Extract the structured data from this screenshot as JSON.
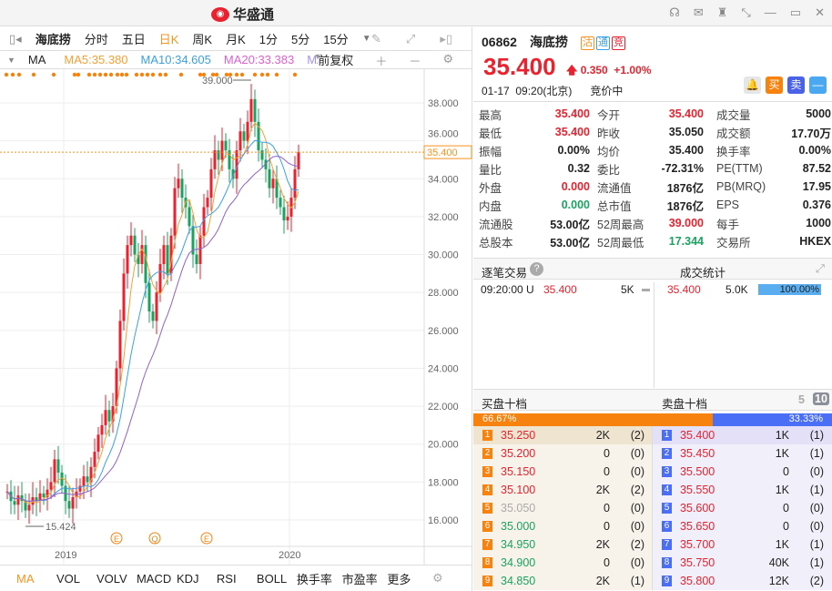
{
  "app": {
    "title": "华盛通",
    "window_controls": [
      "headset-icon",
      "mail-icon",
      "shirt-icon",
      "collapse-icon",
      "minimize-icon",
      "maximize-icon",
      "close-icon"
    ]
  },
  "toolbar": {
    "stock": "海底捞",
    "periods": [
      "分时",
      "五日",
      "日K",
      "周K",
      "月K",
      "1分",
      "5分",
      "15分"
    ],
    "active": "日K"
  },
  "ma": {
    "label": "MA",
    "ma5": "MA5:35.380",
    "ma10": "MA10:34.605",
    "ma20": "MA20:33.383",
    "ma_more": "MA",
    "adjust": "前复权"
  },
  "colors": {
    "up": "#e8222e",
    "down": "#1aa260",
    "ma5": "#f7a035",
    "ma10": "#3aa0e8",
    "ma20": "#e060d0",
    "accent": "#f7931e"
  },
  "chart_data": {
    "type": "candlestick",
    "y_ticks": [
      "38.000",
      "36.000",
      "34.000",
      "32.000",
      "30.000",
      "28.000",
      "26.000",
      "24.000",
      "22.000",
      "20.000",
      "18.000",
      "16.000"
    ],
    "ylim": [
      15,
      39.5
    ],
    "x_labels": [
      "2019",
      "2020"
    ],
    "high_label": "39.000",
    "low_label": "15.424",
    "last_price_label": "35.400",
    "event_markers": [
      "E",
      "Q",
      "E"
    ],
    "closes": [
      17.5,
      17.0,
      16.8,
      17.3,
      17.0,
      16.5,
      16.8,
      17.2,
      17.0,
      17.4,
      17.2,
      17.6,
      18.0,
      19.2,
      18.5,
      17.8,
      17.0,
      16.6,
      17.2,
      17.5,
      17.8,
      18.3,
      18.0,
      18.8,
      19.6,
      20.5,
      21.0,
      21.8,
      21.2,
      22.0,
      24.0,
      26.5,
      29.0,
      30.5,
      31.0,
      30.0,
      29.5,
      30.5,
      28.5,
      27.0,
      26.5,
      28.0,
      29.5,
      30.5,
      29.0,
      31.0,
      33.5,
      34.0,
      33.0,
      32.5,
      31.5,
      30.0,
      29.5,
      31.0,
      32.5,
      33.0,
      34.5,
      35.5,
      35.0,
      36.0,
      35.5,
      34.5,
      34.0,
      35.5,
      36.5,
      36.0,
      37.0,
      38.2,
      37.0,
      35.5,
      35.0,
      34.5,
      33.5,
      34.0,
      33.0,
      32.5,
      31.8,
      32.0,
      33.0,
      34.5,
      35.4
    ]
  },
  "indicators": [
    "MA",
    "VOL",
    "VOLV",
    "MACD",
    "KDJ",
    "RSI",
    "BOLL",
    "换手率",
    "市盈率",
    "更多"
  ],
  "quote": {
    "code": "06862",
    "name": "海底捞",
    "tags": [
      "沽",
      "通",
      "竞"
    ],
    "price": "35.400",
    "change": "0.350",
    "change_pct": "+1.00%",
    "date": "01-17",
    "time": "09:20(北京)",
    "status": "竞价中",
    "buttons": [
      "买",
      "卖"
    ]
  },
  "stats": [
    [
      "最高",
      "35.400",
      "今开",
      "35.400",
      "成交量",
      "5000"
    ],
    [
      "最低",
      "35.400",
      "昨收",
      "35.050",
      "成交额",
      "17.70万"
    ],
    [
      "振幅",
      "0.00%",
      "均价",
      "35.400",
      "换手率",
      "0.00%"
    ],
    [
      "量比",
      "0.32",
      "委比",
      "-72.31%",
      "PE(TTM)",
      "87.52"
    ],
    [
      "外盘",
      "0.000",
      "流通值",
      "1876亿",
      "PB(MRQ)",
      "17.95"
    ],
    [
      "内盘",
      "0.000",
      "总市值",
      "1876亿",
      "EPS",
      "0.376"
    ],
    [
      "流通股",
      "53.00亿",
      "52周最高",
      "39.000",
      "每手",
      "1000"
    ],
    [
      "总股本",
      "53.00亿",
      "52周最低",
      "17.344",
      "交易所",
      "HKEX"
    ]
  ],
  "trades": {
    "title": "逐笔交易",
    "stats_title": "成交统计",
    "rows": [
      {
        "time": "09:20:00 U",
        "price": "35.400",
        "vol": "5K"
      }
    ],
    "stat_rows": [
      {
        "price": "35.400",
        "vol": "5.0K",
        "pct": "100.00%"
      }
    ]
  },
  "orderbook": {
    "bid_title": "买盘十档",
    "ask_title": "卖盘十档",
    "level_5": "5",
    "level_10": "10",
    "bid_pct": "66.67%",
    "ask_pct": "33.33%",
    "bids": [
      [
        "1",
        "35.250",
        "2K",
        "(2)"
      ],
      [
        "2",
        "35.200",
        "0",
        "(0)"
      ],
      [
        "3",
        "35.150",
        "0",
        "(0)"
      ],
      [
        "4",
        "35.100",
        "2K",
        "(2)"
      ],
      [
        "5",
        "35.050",
        "0",
        "(0)"
      ],
      [
        "6",
        "35.000",
        "0",
        "(0)"
      ],
      [
        "7",
        "34.950",
        "2K",
        "(2)"
      ],
      [
        "8",
        "34.900",
        "0",
        "(0)"
      ],
      [
        "9",
        "34.850",
        "2K",
        "(1)"
      ]
    ],
    "asks": [
      [
        "1",
        "35.400",
        "1K",
        "(1)"
      ],
      [
        "2",
        "35.450",
        "1K",
        "(1)"
      ],
      [
        "3",
        "35.500",
        "0",
        "(0)"
      ],
      [
        "4",
        "35.550",
        "1K",
        "(1)"
      ],
      [
        "5",
        "35.600",
        "0",
        "(0)"
      ],
      [
        "6",
        "35.650",
        "0",
        "(0)"
      ],
      [
        "7",
        "35.700",
        "1K",
        "(1)"
      ],
      [
        "8",
        "35.750",
        "40K",
        "(1)"
      ],
      [
        "9",
        "35.800",
        "12K",
        "(2)"
      ]
    ]
  }
}
